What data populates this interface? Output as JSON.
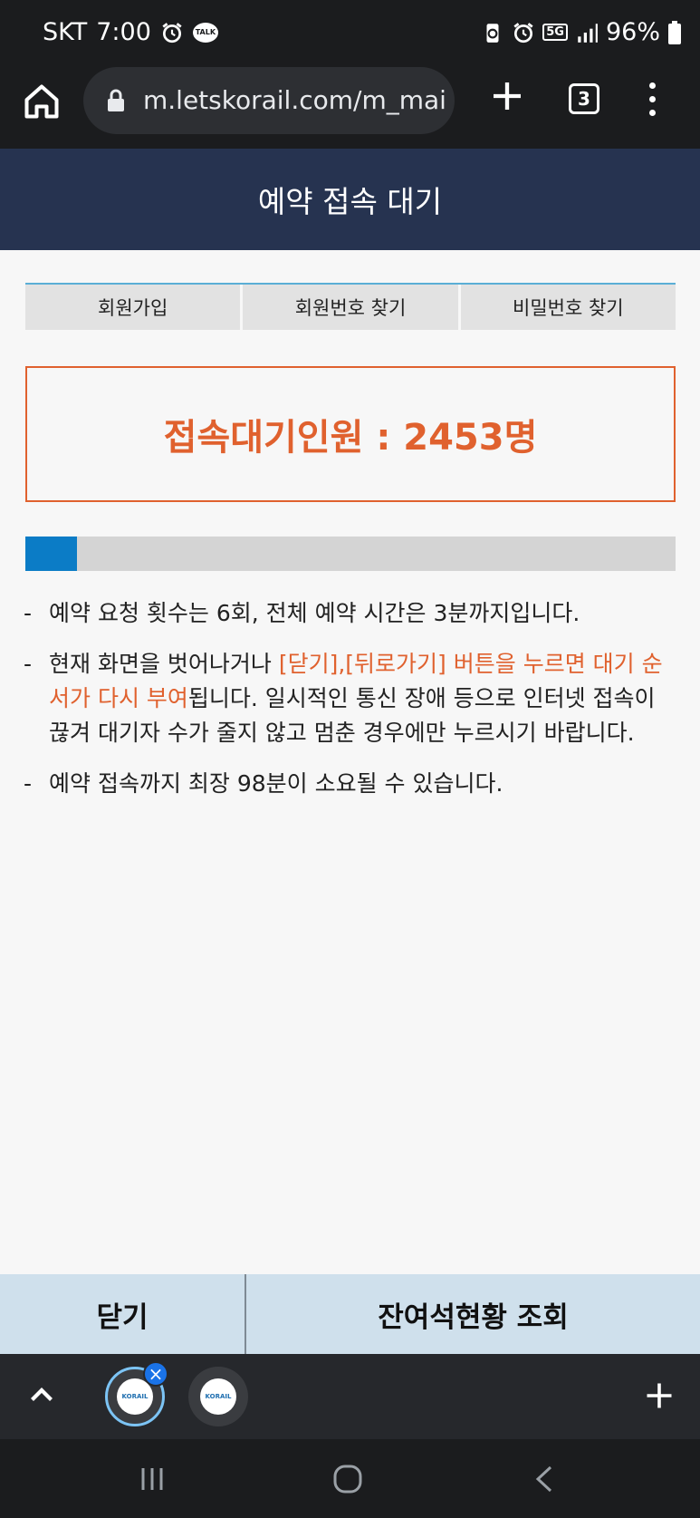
{
  "status_bar": {
    "carrier": "SKT",
    "time": "7:00",
    "talk_badge": "TALK",
    "network": "5G",
    "battery": "96%"
  },
  "browser": {
    "url": "m.letskorail.com/m_mai",
    "tab_count": "3"
  },
  "page": {
    "title": "예약 접속 대기",
    "links": [
      "회원가입",
      "회원번호 찾기",
      "비밀번호 찾기"
    ],
    "queue_label": "접속대기인원 : 2453명",
    "progress_fraction": 0.08,
    "notes": {
      "n1": "예약 요청 횟수는 6회, 전체 예약 시간은 3분까지입니다.",
      "n2_pre": "현재 화면을 벗어나거나 ",
      "n2_em": "[닫기],[뒤로가기] 버튼을 누르면 대기 순서가 다시 부여",
      "n2_post": "됩니다. 일시적인 통신 장애 등으로 인터넷 접속이 끊겨 대기자 수가 줄지 않고 멈춘 경우에만 누르시기 바랍니다.",
      "n3": "예약 접속까지 최장 98분이 소요될 수 있습니다."
    },
    "buttons": {
      "close": "닫기",
      "seat_status": "잔여석현황 조회"
    }
  },
  "colors": {
    "header_bg": "#263350",
    "accent_orange": "#e0612e",
    "progress_blue": "#0b7cc6",
    "bottom_bar": "#cfe0ec"
  },
  "icons": {
    "home": "home-icon",
    "lock": "lock-icon",
    "add_tab": "plus-icon",
    "menu": "more-vert-icon",
    "tray_up": "chevron-up-icon",
    "tab_close": "close-icon",
    "nav_recent": "recent-apps-icon",
    "nav_home": "home-circle-icon",
    "nav_back": "back-icon"
  }
}
